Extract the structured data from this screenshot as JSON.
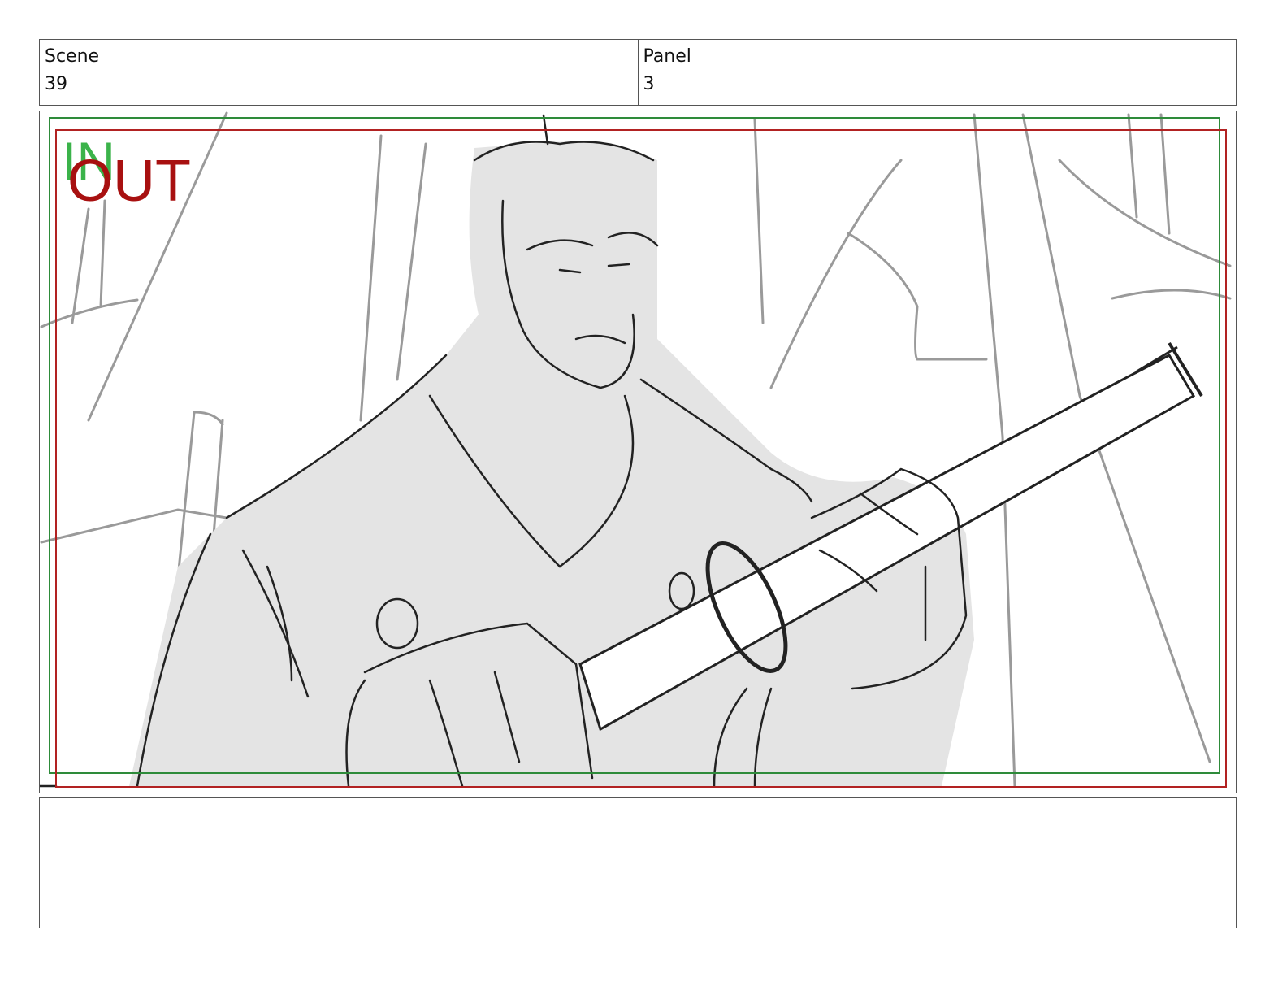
{
  "header": {
    "scene_label": "Scene",
    "scene_value": "39",
    "panel_label": "Panel",
    "panel_value": "3"
  },
  "frame": {
    "in_label": "IN",
    "out_label": "OUT",
    "in_color": "#2e8b3a",
    "out_color": "#b22222",
    "image_description_icon": "storyboard-sketch-samurai-holding-sword"
  },
  "notes": {
    "text": ""
  }
}
